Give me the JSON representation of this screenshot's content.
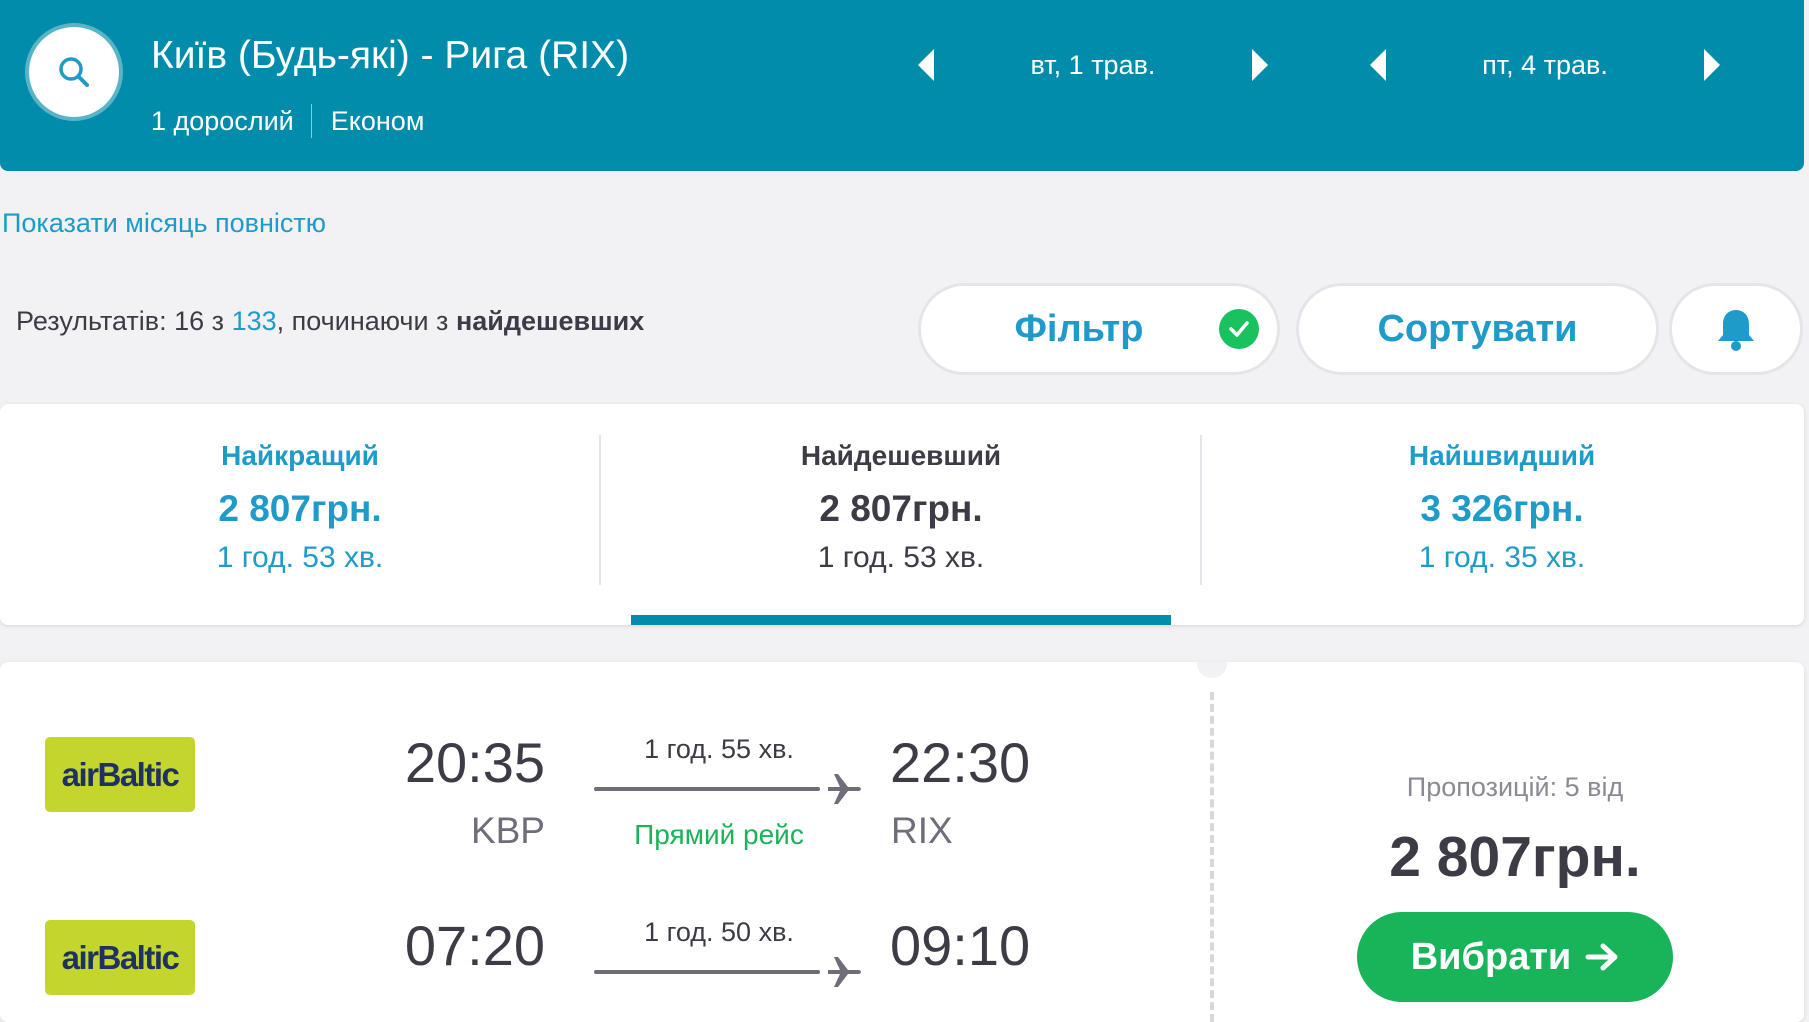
{
  "header": {
    "route": "Київ (Будь-які) - Рига (RIX)",
    "passengers": "1 дорослий",
    "cabin": "Економ",
    "depart_date": "вт, 1 трав.",
    "return_date": "пт, 4 трав."
  },
  "links": {
    "show_month": "Показати місяць повністю"
  },
  "results": {
    "prefix": "Результатів: 16 з ",
    "total": "133",
    "middle": ", починаючи з ",
    "sort_word": "найдешевших"
  },
  "buttons": {
    "filter": "Фільтр",
    "sort": "Сортувати"
  },
  "tabs": [
    {
      "label": "Найкращий",
      "price": "2 807грн.",
      "duration": "1 год. 53 хв."
    },
    {
      "label": "Найдешевший",
      "price": "2 807грн.",
      "duration": "1 год. 53 хв."
    },
    {
      "label": "Найшвидший",
      "price": "3 326грн.",
      "duration": "1 год. 35 хв."
    }
  ],
  "card": {
    "offers": "Пропозицій: 5 від",
    "price": "2 807грн.",
    "select_label": "Вибрати",
    "legs": [
      {
        "airline": "airBaltic",
        "dep_time": "20:35",
        "dep_code": "KBP",
        "duration": "1 год. 55 хв.",
        "stops": "Прямий рейс",
        "arr_time": "22:30",
        "arr_code": "RIX"
      },
      {
        "airline": "airBaltic",
        "dep_time": "07:20",
        "dep_code": "",
        "duration": "1 год. 50 хв.",
        "stops": "",
        "arr_time": "09:10",
        "arr_code": ""
      }
    ]
  },
  "colors": {
    "header": "#008caa",
    "accent_blue": "#1e9bc8",
    "green": "#19b35a",
    "airline_logo": "#c4d62e"
  },
  "icons": [
    "search-icon",
    "chevron-left-icon",
    "chevron-right-icon",
    "check-icon",
    "bell-icon",
    "plane-icon",
    "arrow-right-icon"
  ]
}
